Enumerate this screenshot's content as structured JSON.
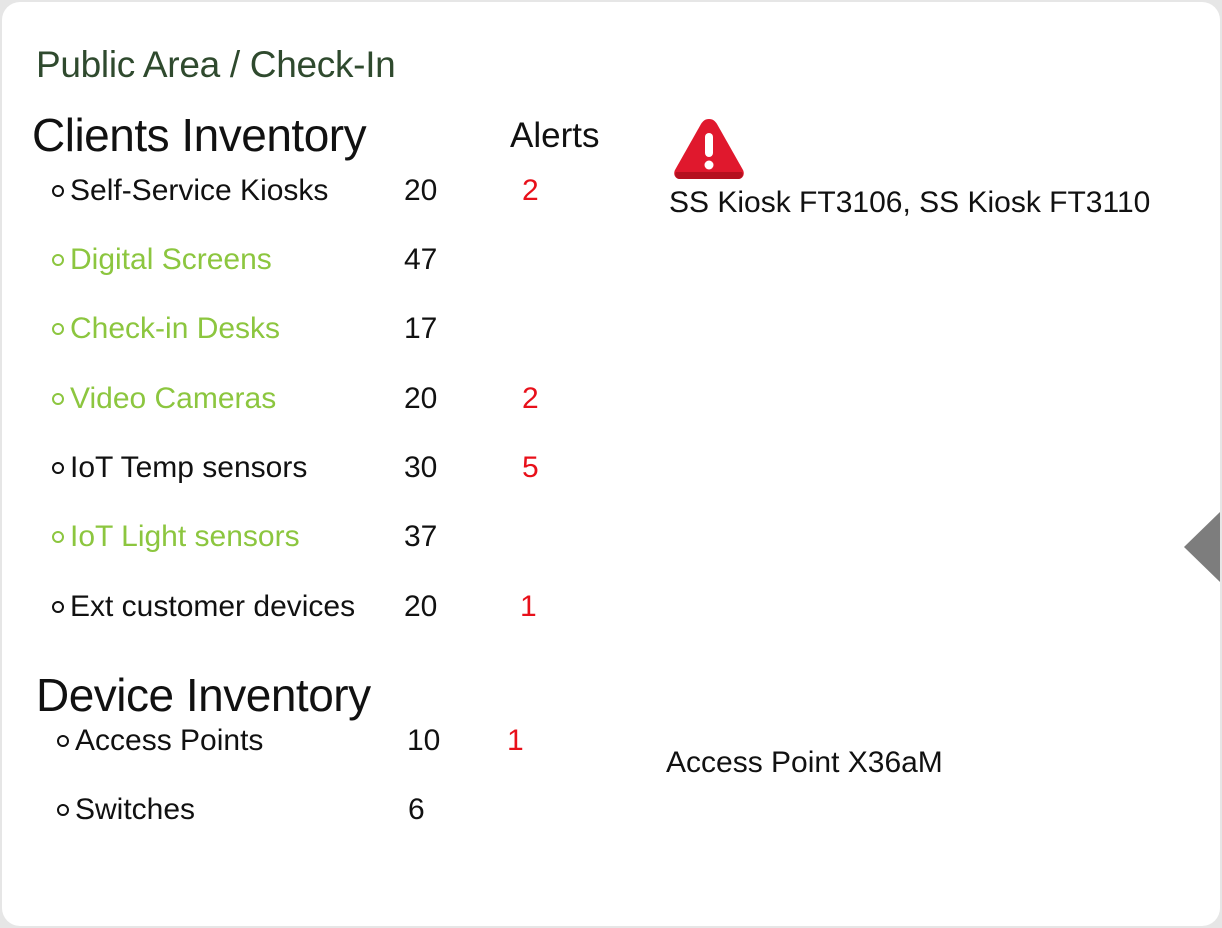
{
  "breadcrumb": "Public Area / Check-In",
  "clients": {
    "title": "Clients Inventory",
    "alerts_header": "Alerts",
    "items": [
      {
        "label": "Self-Service Kiosks",
        "count": "20",
        "alerts": "2",
        "highlight": false
      },
      {
        "label": "Digital Screens",
        "count": "47",
        "alerts": "",
        "highlight": true
      },
      {
        "label": "Check-in Desks",
        "count": "17",
        "alerts": "",
        "highlight": true
      },
      {
        "label": "Video Cameras",
        "count": "20",
        "alerts": "2",
        "highlight": true
      },
      {
        "label": "IoT Temp sensors",
        "count": "30",
        "alerts": "5",
        "highlight": false
      },
      {
        "label": "IoT Light sensors",
        "count": "37",
        "alerts": "",
        "highlight": true
      },
      {
        "label": "Ext customer devices",
        "count": "20",
        "alerts": "1",
        "highlight": false
      }
    ],
    "alert_detail": "SS Kiosk FT3106, SS Kiosk FT3110",
    "alert_icon": "warning-triangle-icon"
  },
  "devices": {
    "title": "Device Inventory",
    "items": [
      {
        "label": "Access Points",
        "count": "10",
        "alerts": "1"
      },
      {
        "label": "Switches",
        "count": "6",
        "alerts": ""
      }
    ],
    "alert_detail": "Access Point X36aM"
  },
  "colors": {
    "breadcrumb": "#2f4a2e",
    "highlight_green": "#8cc63f",
    "alert_red": "#e8101a",
    "warning_red": "#e0182d"
  }
}
